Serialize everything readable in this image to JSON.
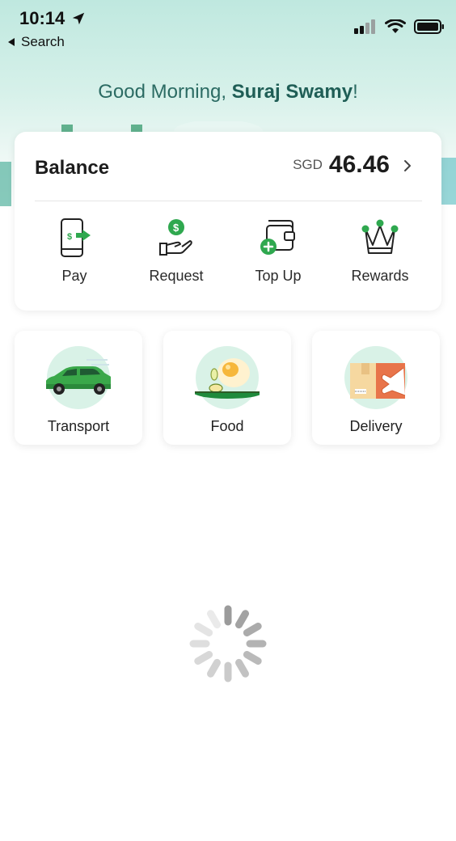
{
  "status_bar": {
    "time": "10:14",
    "back_label": "Search"
  },
  "header": {
    "greeting_prefix": "Good Morning, ",
    "user_name": "Suraj Swamy",
    "greeting_suffix": "!"
  },
  "balance": {
    "label": "Balance",
    "currency": "SGD",
    "amount": "46.46"
  },
  "actions": [
    {
      "label": "Pay",
      "icon": "pay-phone-icon"
    },
    {
      "label": "Request",
      "icon": "request-hand-icon"
    },
    {
      "label": "Top Up",
      "icon": "top-up-wallet-icon"
    },
    {
      "label": "Rewards",
      "icon": "crown-icon"
    }
  ],
  "services": [
    {
      "label": "Transport",
      "icon": "car-icon"
    },
    {
      "label": "Food",
      "icon": "food-plate-icon"
    },
    {
      "label": "Delivery",
      "icon": "package-icon"
    }
  ],
  "colors": {
    "brand_green": "#2fa84f",
    "greeting_text": "#2b6b63",
    "hero_gradient_top": "#bfe8df"
  }
}
